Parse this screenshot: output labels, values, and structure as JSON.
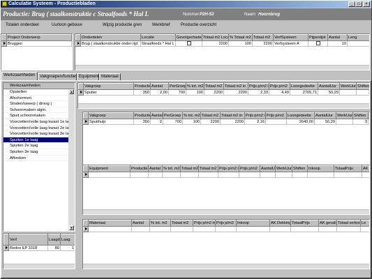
{
  "window": {
    "title": "Calculatie Systeem - Productiebladen"
  },
  "header": {
    "title": "Productie: Brug ( staalkonstruktie c Straalfoods * Hal L",
    "number_label": "Nummer",
    "number_value": "P2H-53",
    "name_label": "Naam",
    "name_value": "Hoornbrug"
  },
  "menu": [
    "Totalen onderdeel",
    "Uurloon gebouw",
    "Wijzig productie gren",
    "Werkbrief",
    "Productie overzicht"
  ],
  "project": {
    "header": "Project Onderwerp",
    "items": [
      "Bruggen"
    ]
  },
  "onderdelen": {
    "columns": [
      "Onderdelen",
      "Locatie",
      "Gevolgschade",
      "Totaal m2 Locatie",
      "% Totaal m2 in",
      "Totaal m2",
      "VerfSysteem",
      "Pijpenlijst",
      "Aantal",
      "Leng"
    ],
    "rows": [
      [
        "Brug ( staalkonstruktie onder rijd",
        "Straalfoods * Hal L",
        "",
        "2200",
        "100",
        "2200",
        "Verfsysteem A",
        "",
        "10",
        ""
      ]
    ]
  },
  "tabs": [
    "Werkzaamheden",
    "Vakgroepen/functies",
    "Equipment",
    "Materiaal"
  ],
  "werkzaamheden": {
    "header": "Werkzaamheden",
    "items": [
      "Opstellen",
      "Afschermen",
      "Stralen/sweep ( droog )",
      "Schoonmaken algm.",
      "Spuit schoonmaken",
      "Voorzetten/volle laag kwast 1e laag",
      "Voorzetten/volle laag kwast 2e laag",
      "Voorzetten/volle laag kwast 3e laag",
      "Spuiten 1e laag",
      "Spuiten 2e laag",
      "Spuiten 3e laag",
      "Afbreken"
    ],
    "selected": 8
  },
  "verf": {
    "columns": [
      "Verf",
      "Laagdikte",
      "Laag"
    ],
    "rows": [
      [
        "Redox EP 3318",
        "80",
        "1"
      ]
    ]
  },
  "vakgroep_top": {
    "columns": [
      "Vakgroep",
      "Productie",
      "Aantal",
      "PerGroep",
      "% tot. m2",
      "Totaal m2",
      "Totaal m2 in",
      "Prijs p/m2 in",
      "Prijs p/m2",
      "Loongedeelte",
      "AantalUur",
      "WerkUur",
      "Shiften",
      "TotaalPrijs",
      "A"
    ],
    "rows": [
      [
        "Spuiter",
        "350",
        "2,00",
        "700",
        "100",
        "2200",
        "2200",
        "2,33",
        "4,49",
        "2765,71",
        "50,29",
        "",
        "3",
        "5116,57",
        ""
      ]
    ]
  },
  "vakgroep_mid": {
    "columns": [
      "Vakgroep",
      "Productie",
      "Aantal",
      "PerGroep",
      "% tot. m2",
      "Totaal m2",
      "Totaal m2 in",
      "Prijs p/m2 in",
      "Prijs p/m2",
      "Loongedeelte",
      "AantalUur",
      "WerkUur",
      "Shiften",
      "TotaalPrijs"
    ],
    "rows": [
      [
        "Spuithulp",
        "350",
        "2",
        "700",
        "100",
        "2200",
        "2200",
        "2,16",
        "",
        "2640,00",
        "50,29",
        "",
        "3",
        "4752"
      ]
    ]
  },
  "equipment": {
    "columns": [
      "Equipment",
      "Productie",
      "Aantal",
      "% tot. m2",
      "Totaal m2",
      "Totaal m2 in",
      "Prijs p/m2 in",
      "Prijs p/m2",
      "AantalUur",
      "WerkUur",
      "Shiften",
      "Inkoop",
      "TotaalPrijs",
      "AK Dekking"
    ]
  },
  "materiaal": {
    "columns": [
      "Materiaal",
      "Aantal",
      "% tot. m2",
      "Totaal m2",
      "Prijs p/m2 in",
      "Prijs p/m2",
      "Inkoop",
      "AK Dekking",
      "TotaalPrijs",
      "AK gevalijge",
      "Totaal verkoop",
      "Le"
    ]
  },
  "scroll": {
    "left": "◄",
    "right": "►",
    "up": "▲",
    "down": "▼"
  },
  "colors": {
    "title_start": "#0a246a",
    "title_end": "#a6caf0",
    "header_bg": "#808080",
    "face": "#c0c0c0",
    "selection": "#000080"
  }
}
